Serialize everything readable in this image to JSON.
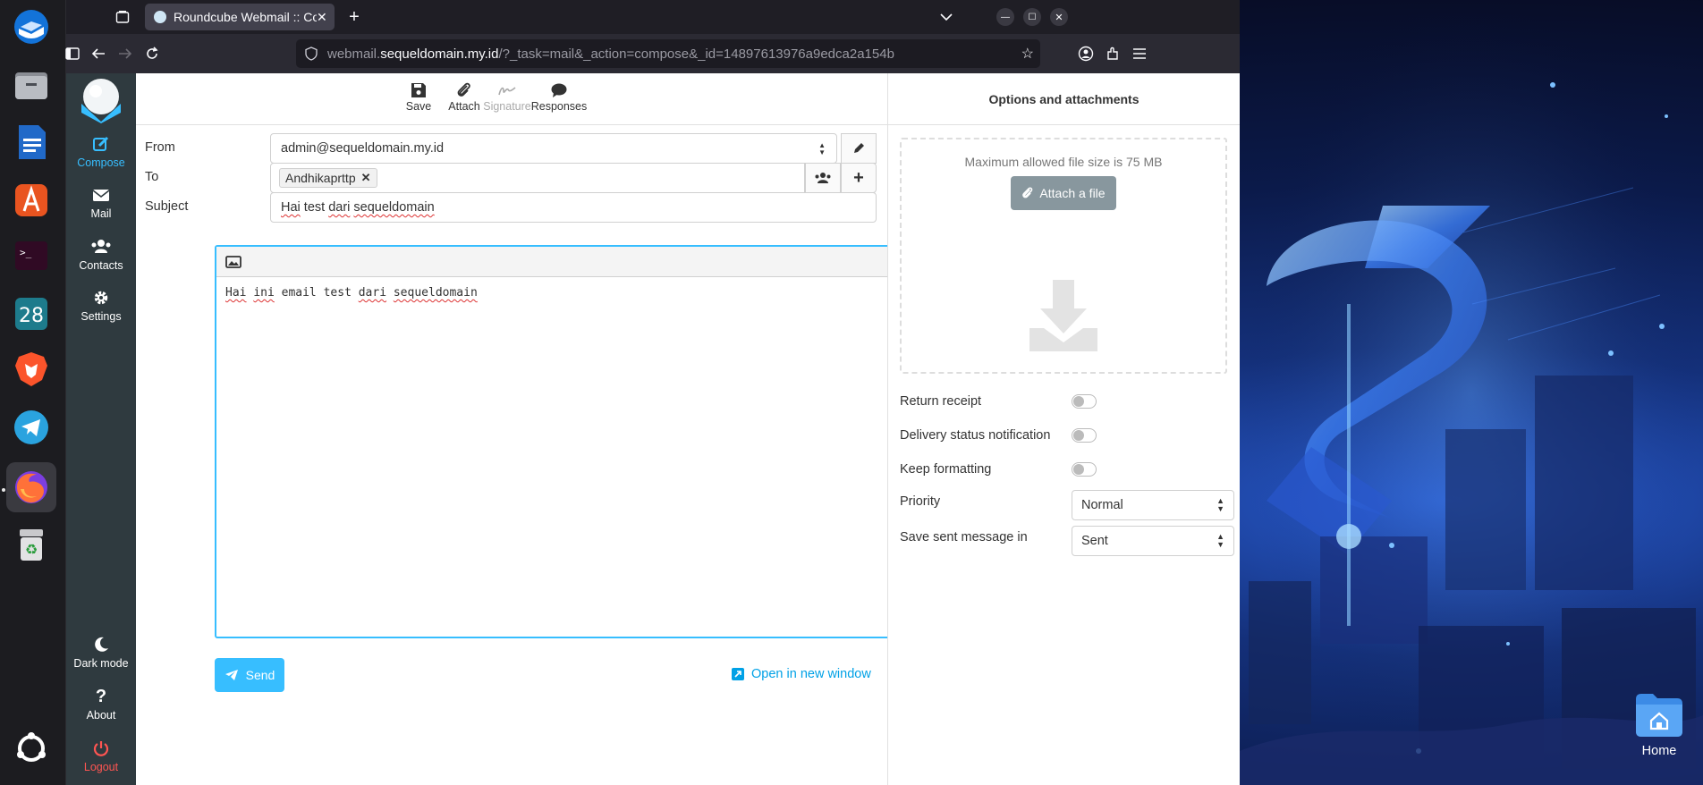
{
  "browser": {
    "tab_title": "Roundcube Webmail :: Co",
    "url_prefix": "webmail.",
    "url_host": "sequeldomain.my.id",
    "url_path": "/?_task=mail&_action=compose&_id=14897613976a9edca2a154b"
  },
  "rc_nav": {
    "compose": "Compose",
    "mail": "Mail",
    "contacts": "Contacts",
    "settings": "Settings",
    "dark_mode": "Dark mode",
    "about": "About",
    "logout": "Logout"
  },
  "toolbar": {
    "save": "Save",
    "attach": "Attach",
    "signature": "Signature",
    "responses": "Responses"
  },
  "compose": {
    "from_label": "From",
    "from_value": "admin@sequeldomain.my.id",
    "to_label": "To",
    "to_recipient": "Andhikaprttp",
    "subject_label": "Subject",
    "subject_value": "Hai test dari sequeldomain",
    "body_text": "Hai ini email test dari sequeldomain",
    "send": "Send",
    "open_new_window": "Open in new window"
  },
  "options": {
    "header": "Options and attachments",
    "max_size_hint": "Maximum allowed file size is 75 MB",
    "attach_file": "Attach a file",
    "return_receipt": "Return receipt",
    "delivery_status": "Delivery status notification",
    "keep_formatting": "Keep formatting",
    "priority_label": "Priority",
    "priority_value": "Normal",
    "save_sent_label": "Save sent message in",
    "save_sent_value": "Sent"
  },
  "desktop": {
    "home_label": "Home",
    "calendar_day": "28"
  },
  "colors": {
    "accent": "#37beff",
    "nav_bg": "#2f3a3f",
    "logout": "#ff5552"
  }
}
